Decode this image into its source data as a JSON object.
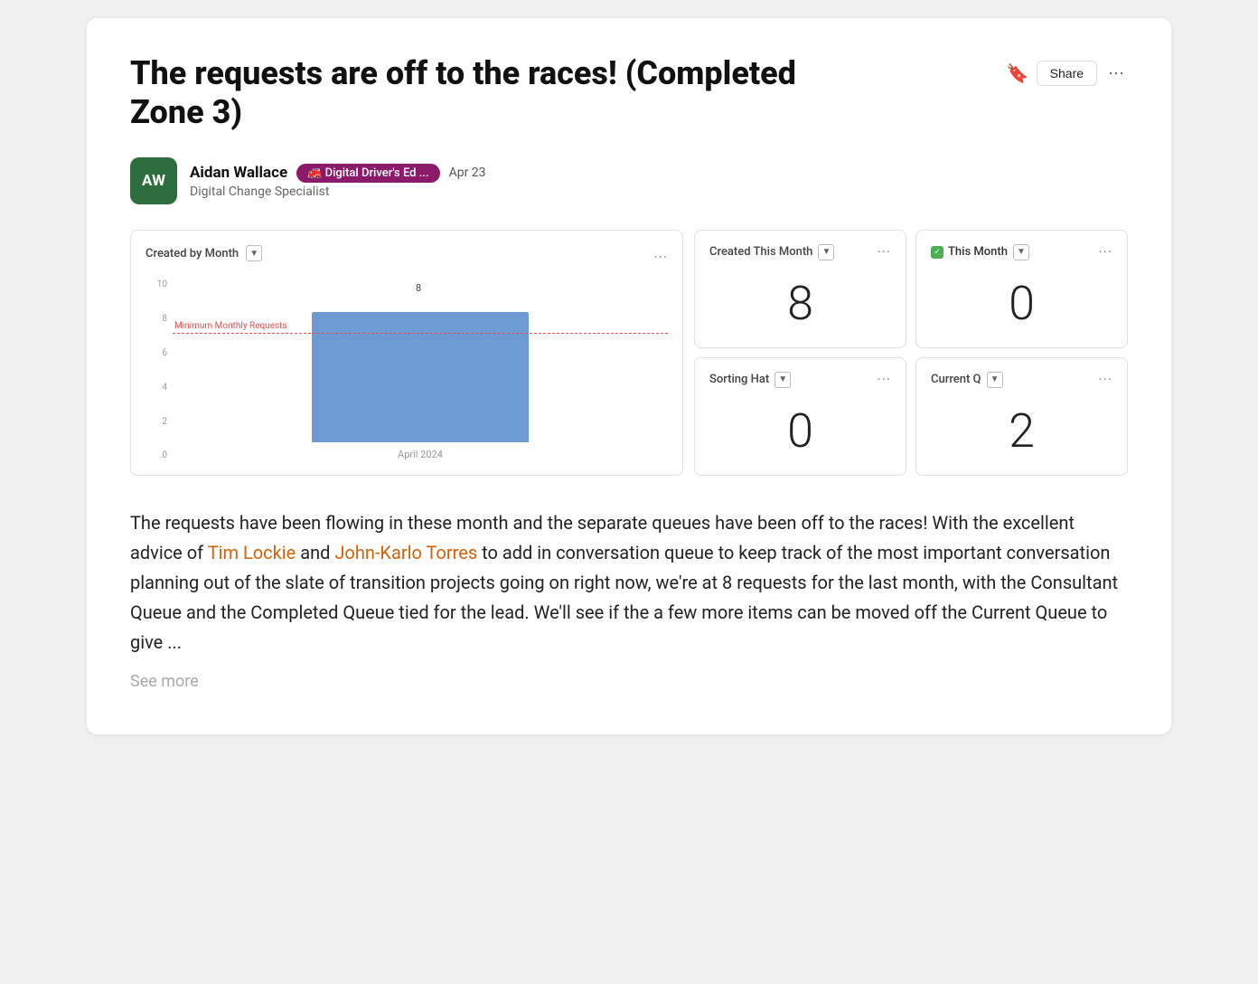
{
  "page": {
    "title": "The requests are off to the races! (Completed Zone 3)",
    "share_label": "Share",
    "bookmark_symbol": "🔖",
    "dots_symbol": "···"
  },
  "author": {
    "initials": "AW",
    "name": "Aidan Wallace",
    "tag": "🚒 Digital Driver's Ed ...",
    "date": "Apr 23",
    "role": "Digital Change Specialist"
  },
  "chart": {
    "title": "Created by Month",
    "bar_value": "8",
    "x_label": "April 2024",
    "ref_line_label": "Minimum Monthly Requests",
    "y_labels": [
      "0",
      "2",
      "4",
      "6",
      "8",
      "10"
    ],
    "bar_height_pct": 80,
    "ref_line_pct": 60
  },
  "stats": [
    {
      "id": "created-this-month",
      "title": "Created This Month",
      "value": "8",
      "has_filter": true,
      "has_check": false
    },
    {
      "id": "this-month",
      "title": "This Month",
      "value": "0",
      "has_filter": true,
      "has_check": true
    },
    {
      "id": "sorting-hat",
      "title": "Sorting Hat",
      "value": "0",
      "has_filter": true,
      "has_check": false
    },
    {
      "id": "current-q",
      "title": "Current Q",
      "value": "2",
      "has_filter": true,
      "has_check": false
    }
  ],
  "body": {
    "paragraph": "The requests have been flowing in these month and the separate queues have been off to the races! With the excellent advice of",
    "link1": "Tim Lockie",
    "and_text": "and",
    "link2": "John-Karlo Torres",
    "rest": "to add in conversation queue to keep track of the most important conversation planning out of the slate of transition projects going on right now, we're at 8 requests for the last month, with the Consultant Queue and the Completed Queue tied for the lead. We'll see if the a few more items can be moved off the Current Queue to give ...",
    "see_more": "See more"
  }
}
